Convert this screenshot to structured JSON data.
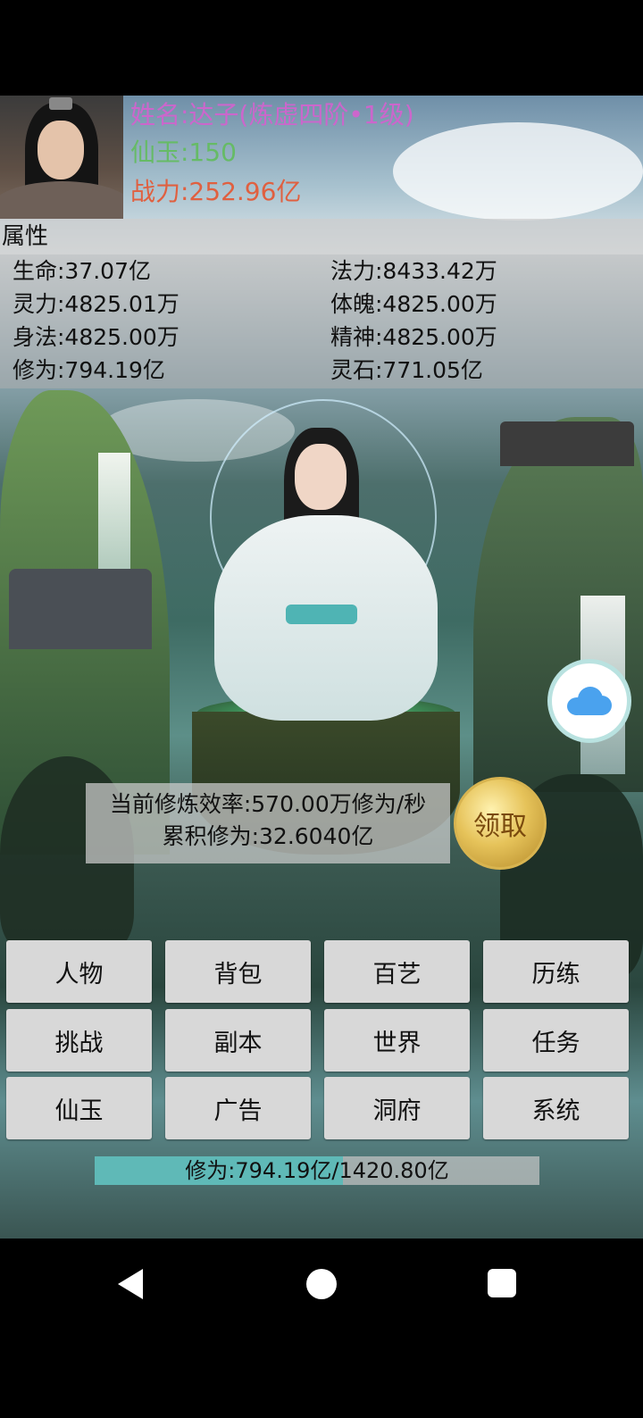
{
  "player": {
    "name": "姓名:达子(炼虚四阶•1级)",
    "jade": "仙玉:150",
    "power": "战力:252.96亿"
  },
  "colors": {
    "name": "#cc66cc",
    "jade": "#66bb66",
    "power": "#e06040",
    "progress_fill": "#5fb9b7",
    "cloud_icon": "#4aa2ee"
  },
  "attributes": {
    "title": "属性",
    "items": [
      "生命:37.07亿",
      "法力:8433.42万",
      "灵力:4825.01万",
      "体魄:4825.00万",
      "身法:4825.00万",
      "精神:4825.00万",
      "修为:794.19亿",
      "灵石:771.05亿"
    ]
  },
  "cultivation": {
    "efficiency": "当前修炼效率:570.00万修为/秒",
    "accumulated": "累积修为:32.6040亿",
    "claim_label": "领取"
  },
  "menu": [
    "人物",
    "背包",
    "百艺",
    "历练",
    "挑战",
    "副本",
    "世界",
    "任务",
    "仙玉",
    "广告",
    "洞府",
    "系统"
  ],
  "progress": {
    "text": "修为:794.19亿/1420.80亿",
    "current": 794.19,
    "max": 1420.8
  },
  "icons": {
    "cloud": "cloud-icon",
    "back": "back-icon",
    "home": "home-icon",
    "recent": "recent-apps-icon"
  }
}
